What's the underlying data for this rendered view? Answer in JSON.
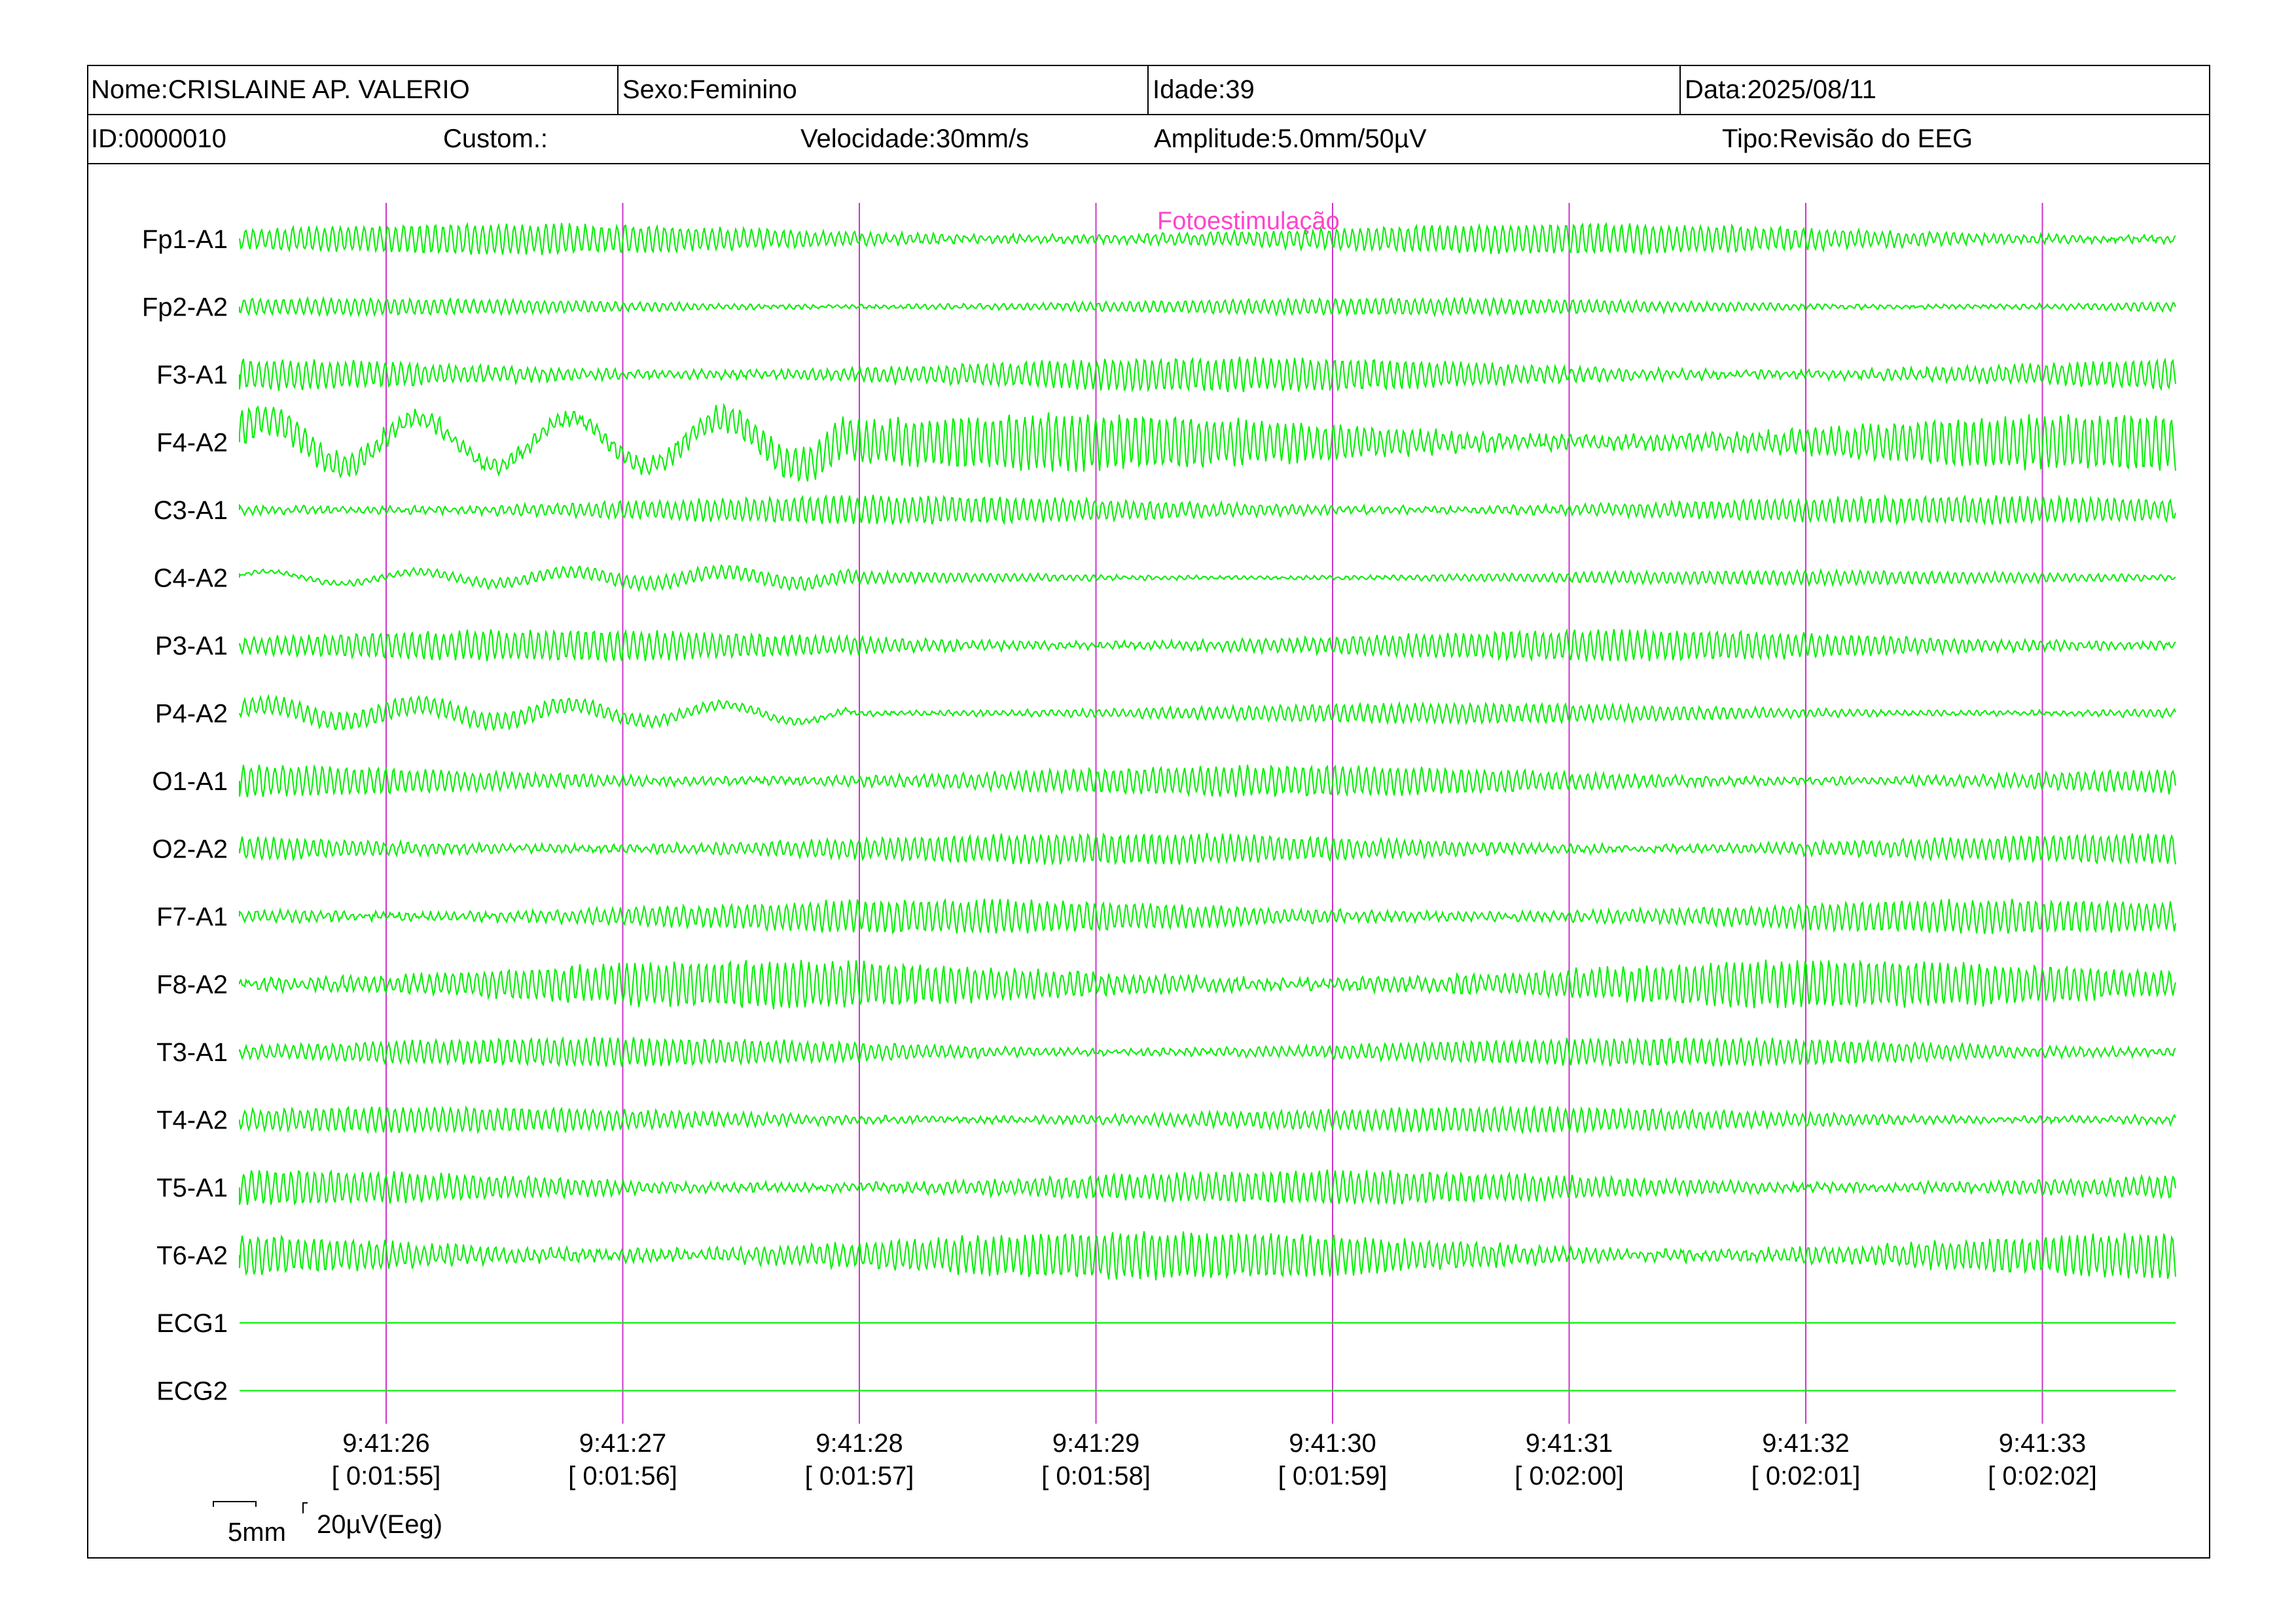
{
  "header": {
    "nome": "Nome:CRISLAINE AP. VALERIO",
    "sexo": "Sexo:Feminino",
    "idade": "Idade:39",
    "data": "Data:2025/08/11",
    "id": "ID:0000010",
    "custom": "Custom.:",
    "velocidade": "Velocidade:30mm/s",
    "amplitude": "Amplitude:5.0mm/50µV",
    "tipo": "Tipo:Revisão do EEG"
  },
  "event_marker": {
    "label": "Fotoestimulação",
    "color": "#ff44cc"
  },
  "colors": {
    "trace": "#00ee00",
    "marker": "#cc33cc",
    "grid": "#000000"
  },
  "channels": [
    "Fp1-A1",
    "Fp2-A2",
    "F3-A1",
    "F4-A2",
    "C3-A1",
    "C4-A2",
    "P3-A1",
    "P4-A2",
    "O1-A1",
    "O2-A2",
    "F7-A1",
    "F8-A2",
    "T3-A1",
    "T4-A2",
    "T5-A1",
    "T6-A2",
    "ECG1",
    "ECG2"
  ],
  "time_marks": [
    {
      "clock": "9:41:26",
      "elapsed": "[ 0:01:55]"
    },
    {
      "clock": "9:41:27",
      "elapsed": "[ 0:01:56]"
    },
    {
      "clock": "9:41:28",
      "elapsed": "[ 0:01:57]"
    },
    {
      "clock": "9:41:29",
      "elapsed": "[ 0:01:58]"
    },
    {
      "clock": "9:41:30",
      "elapsed": "[ 0:01:59]"
    },
    {
      "clock": "9:41:31",
      "elapsed": "[ 0:02:00]"
    },
    {
      "clock": "9:41:32",
      "elapsed": "[ 0:02:01]"
    },
    {
      "clock": "9:41:33",
      "elapsed": "[ 0:02:02]"
    }
  ],
  "scale": {
    "time_label": "5mm",
    "amp_label": "20µV(Eeg)"
  }
}
